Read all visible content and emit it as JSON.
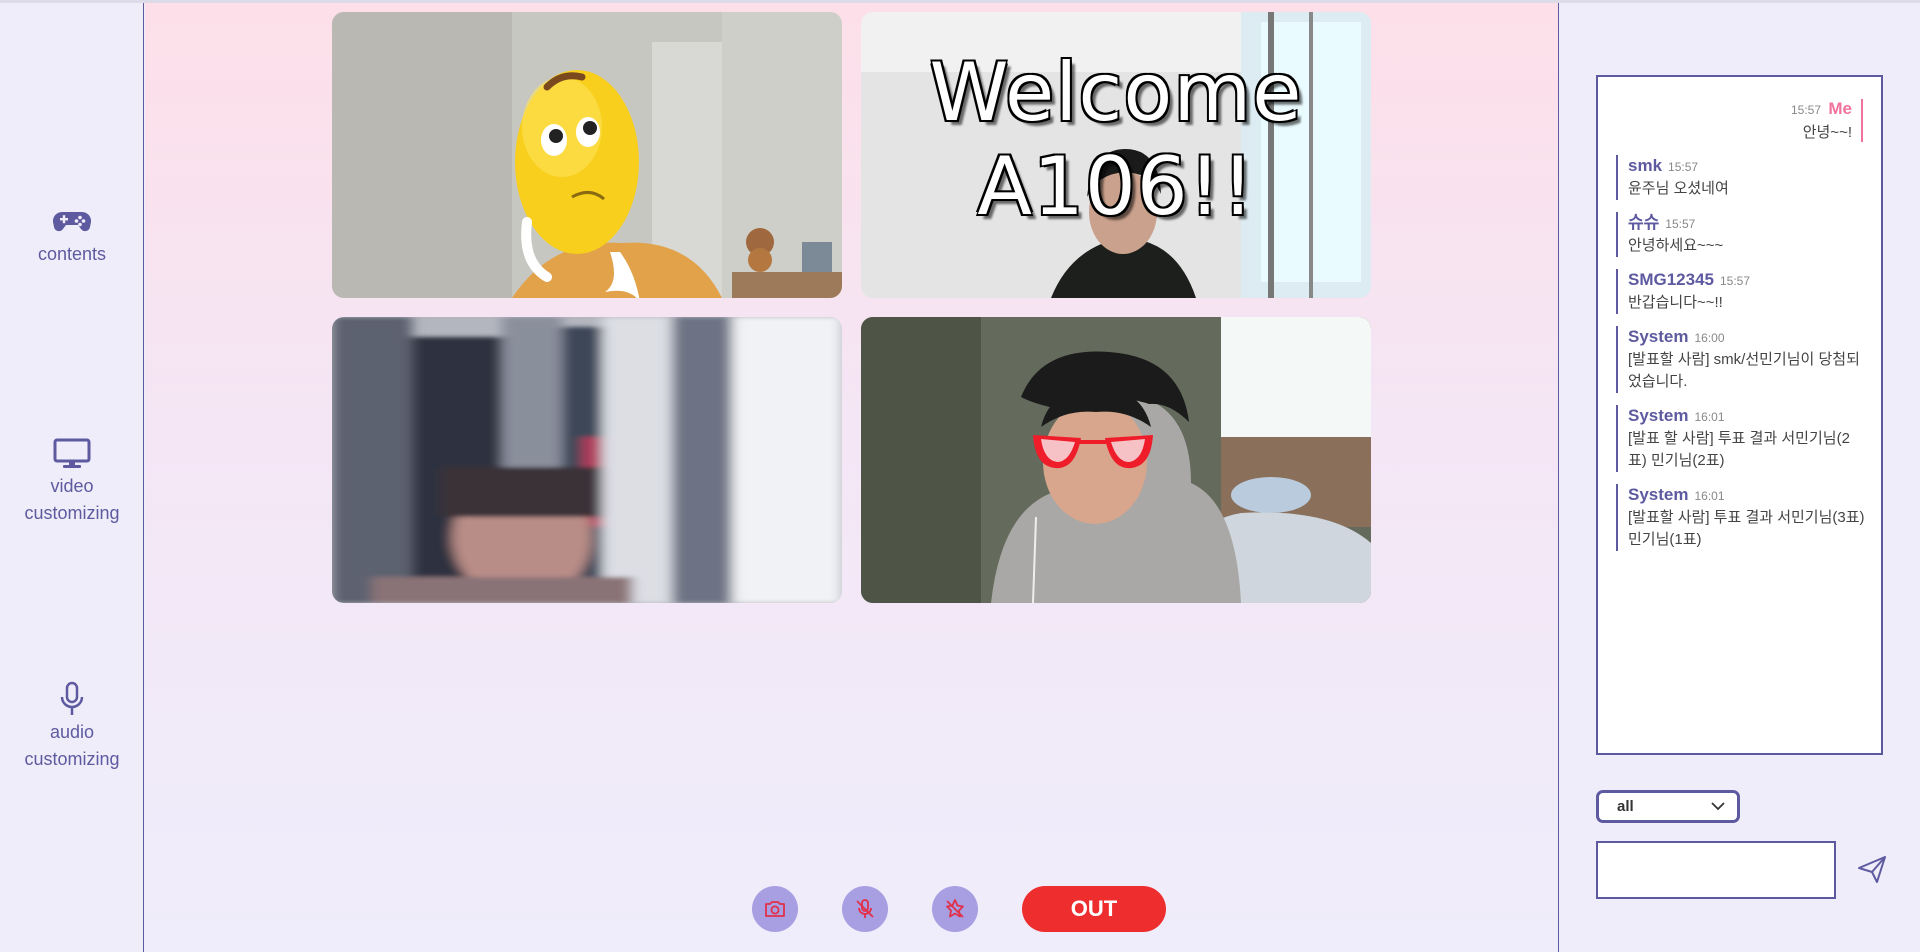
{
  "sidebar": {
    "items": [
      {
        "label": "contents",
        "icon": "gamepad-icon"
      },
      {
        "label": "video\ncustomizing",
        "icon": "monitor-icon"
      },
      {
        "label": "audio\ncustomizing",
        "icon": "microphone-icon"
      }
    ]
  },
  "video": {
    "tiles": [
      {
        "overlay": "emoji-mask"
      },
      {
        "overlay_text": "Welcome\nA106!!"
      },
      {
        "overlay": "blur"
      },
      {
        "overlay": "red-glasses"
      }
    ]
  },
  "controls": {
    "camera_icon": "camera-icon",
    "mic_icon": "mic-off-icon",
    "effects_icon": "sparkle-off-icon",
    "out_label": "OUT"
  },
  "chat": {
    "me": {
      "name": "Me",
      "time": "15:57",
      "text": "안녕~~!"
    },
    "messages": [
      {
        "name": "smk",
        "time": "15:57",
        "text": "윤주님 오셨네여"
      },
      {
        "name": "슈슈",
        "time": "15:57",
        "text": "안녕하세요~~~"
      },
      {
        "name": "SMG12345",
        "time": "15:57",
        "text": "반갑습니다~~!!"
      },
      {
        "name": "System",
        "time": "16:00",
        "text": "[발표할 사람] smk/선민기님이 당첨되었습니다."
      },
      {
        "name": "System",
        "time": "16:01",
        "text": "[발표 할 사람] 투표 결과 서민기님(2표) 민기님(2표)"
      },
      {
        "name": "System",
        "time": "16:01",
        "text": "[발표할 사람] 투표 결과 서민기님(3표) 민기님(1표)"
      }
    ],
    "target_select": "all",
    "input_value": "",
    "send_icon": "send-icon"
  },
  "colors": {
    "accent": "#5e5aa0",
    "button": "#a79fe2",
    "out": "#ee2e2e",
    "me": "#f0729e"
  }
}
